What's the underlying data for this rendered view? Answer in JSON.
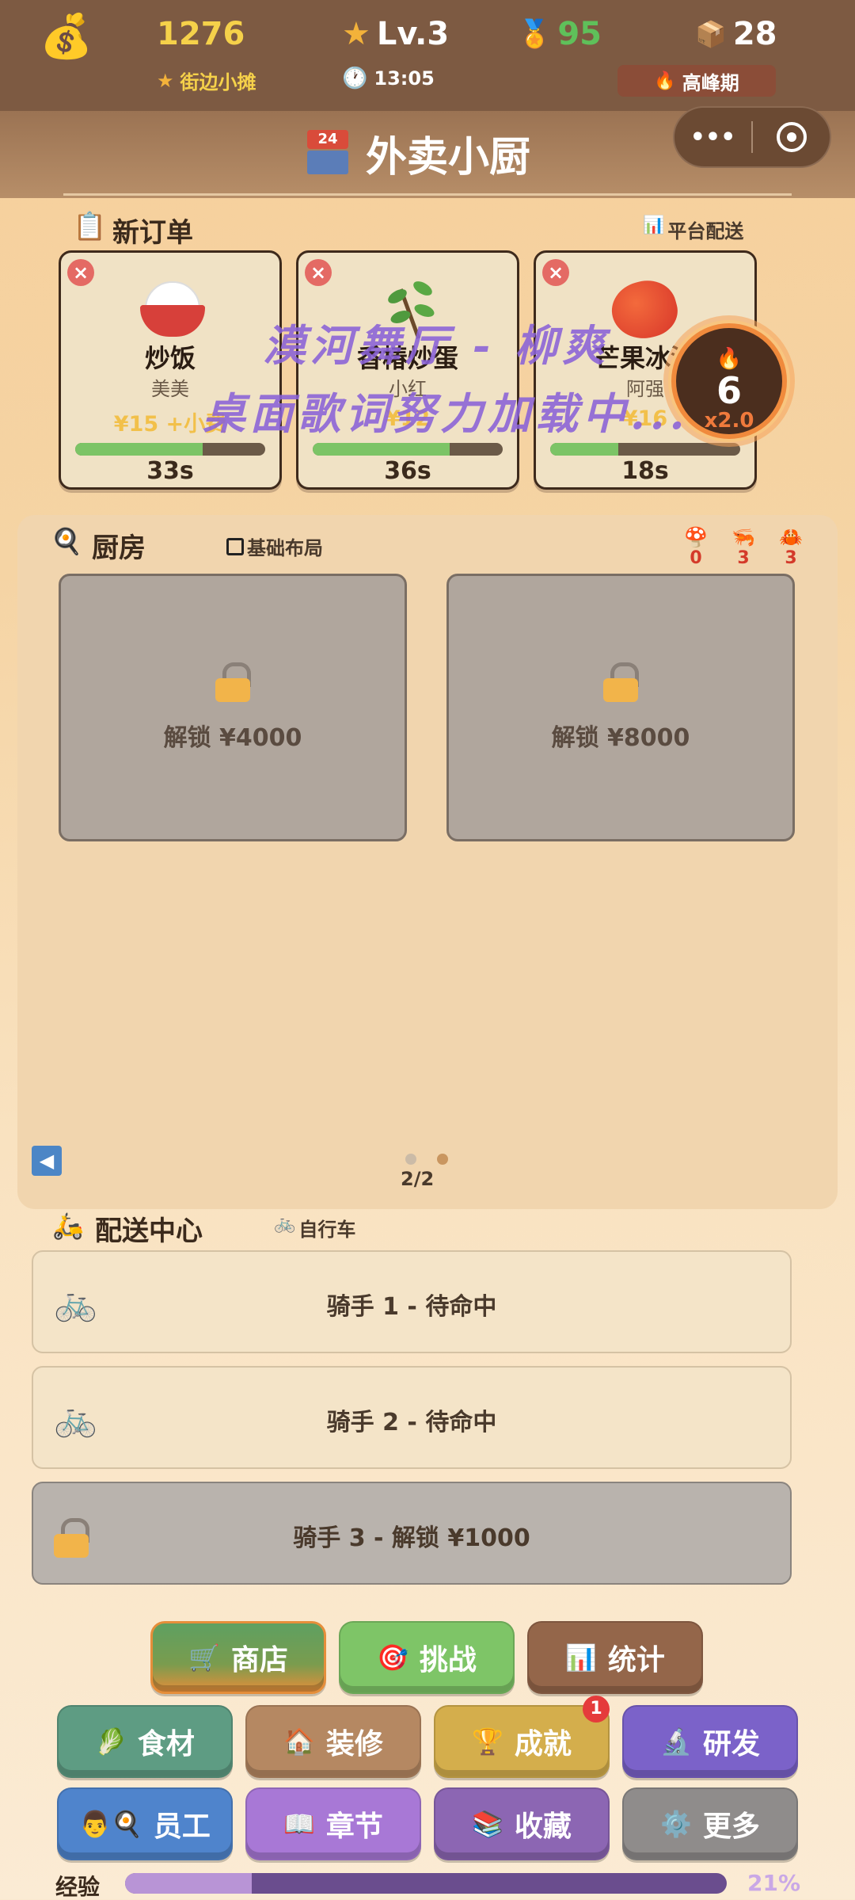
{
  "top": {
    "coins": "1276",
    "level": "Lv.3",
    "medals": "95",
    "boxes": "28",
    "shop_name": "街边小摊",
    "time": "13:05",
    "period": "高峰期"
  },
  "title": {
    "text": "外卖小厨",
    "badge": "24"
  },
  "orders": {
    "header": "新订单",
    "platform": "平台配送",
    "cards": [
      {
        "dish": "炒饭",
        "customer": "美美",
        "price": "¥15 +小费",
        "time": "33s",
        "progress": 0.67,
        "icon": "rice-bowl-icon"
      },
      {
        "dish": "香椿炒蛋",
        "customer": "小红",
        "price": "¥12",
        "time": "36s",
        "progress": 0.72,
        "icon": "toon-sprig-icon"
      },
      {
        "dish": "芒果冰沙",
        "customer": "阿强",
        "price": "¥16",
        "time": "18s",
        "progress": 0.36,
        "icon": "mango-icon"
      }
    ]
  },
  "combo": {
    "count": "6",
    "multiplier": "x2.0"
  },
  "overlay": {
    "line1": "漠河舞厅 - 柳爽",
    "line2": "桌面歌词努力加载中..."
  },
  "kitchen": {
    "header": "厨房",
    "layout": "基础布局",
    "ing": [
      "0",
      "3",
      "3"
    ],
    "slots": [
      {
        "label": "解锁 ¥4000"
      },
      {
        "label": "解锁 ¥8000"
      }
    ],
    "page": "2/2"
  },
  "delivery": {
    "header": "配送中心",
    "vehicle": "自行车",
    "riders": [
      {
        "label": "骑手 1 - 待命中"
      },
      {
        "label": "骑手 2 - 待命中"
      },
      {
        "label": "骑手 3 - 解锁 ¥1000"
      }
    ]
  },
  "buttons": {
    "shop": "商店",
    "challenge": "挑战",
    "stats": "统计",
    "ingredients": "食材",
    "decor": "装修",
    "achieve": "成就",
    "achieve_badge": "1",
    "research": "研发",
    "staff": "员工",
    "chapter": "章节",
    "collection": "收藏",
    "more": "更多"
  },
  "exp": {
    "label": "经验",
    "percent": "21%",
    "value": 0.21
  },
  "colors": {
    "topbar": "#7d5a42",
    "shop_green": "#62a05a",
    "challenge_green": "#7ec567",
    "stats_brown": "#94664a",
    "teal": "#5e9c83",
    "decor": "#b58862",
    "gold": "#d4ae4c",
    "purple": "#7b62c9",
    "blue": "#4f84cc",
    "violet": "#a878d6",
    "grape": "#8c66b3",
    "gray": "#8f8c8b"
  }
}
